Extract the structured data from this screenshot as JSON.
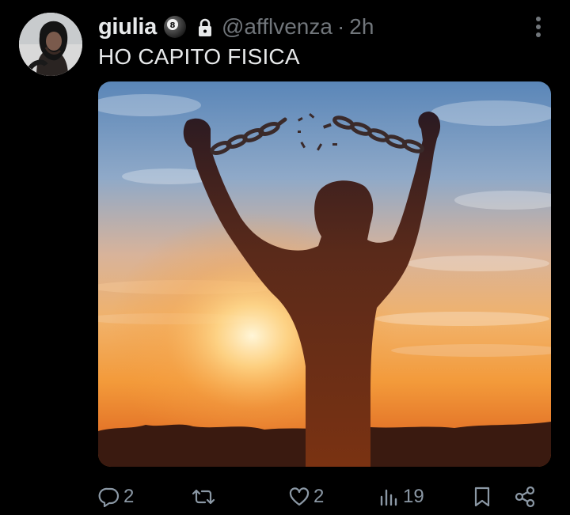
{
  "tweet": {
    "display_name": "giulia",
    "handle": "@afflvenza",
    "separator": "·",
    "time": "2h",
    "text": "HO CAPITO FISICA",
    "badge_icon": "8-ball-emoji-icon",
    "protected_icon": "lock-icon",
    "media_description_icon": "photo"
  },
  "actions": {
    "reply_count": "2",
    "retweet_count": "",
    "like_count": "2",
    "views_count": "19"
  },
  "colors": {
    "background": "#000000",
    "text": "#e7e9ea",
    "muted": "#71767b",
    "icon": "#8b98a5"
  }
}
